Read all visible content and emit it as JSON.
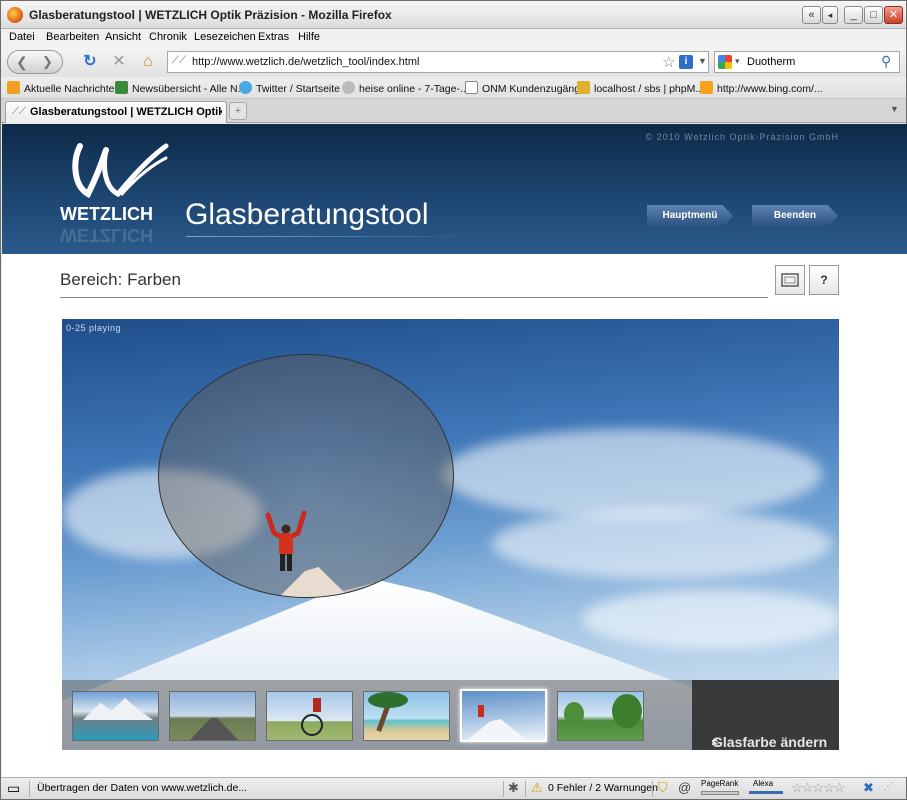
{
  "window": {
    "title": "Glasberatungstool | WETZLICH Optik Präzision - Mozilla Firefox",
    "buttons": {
      "back_left": "«",
      "minimize": "_",
      "maximize": "□",
      "close": "✕"
    }
  },
  "menu": [
    "Datei",
    "Bearbeiten",
    "Ansicht",
    "Chronik",
    "Lesezeichen",
    "Extras",
    "Hilfe"
  ],
  "nav": {
    "url": "http://www.wetzlich.de/wetzlich_tool/index.html",
    "search_value": "Duotherm",
    "icons": [
      "back-icon",
      "forward-icon",
      "reload-icon",
      "stop-icon",
      "home-icon",
      "bookmark-star-icon",
      "search-icon"
    ]
  },
  "bookmarks": [
    {
      "label": "Aktuelle Nachrichten",
      "color": "#f0a020"
    },
    {
      "label": "Newsübersicht - Alle N...",
      "color": "#3a8a3a"
    },
    {
      "label": "Twitter / Startseite",
      "color": "#4aa8e0"
    },
    {
      "label": "heise online - 7-Tage-...",
      "color": "#bbbbbb"
    },
    {
      "label": "ONM Kundenzugänge",
      "color": "#ffffff"
    },
    {
      "label": "localhost / sbs | phpM...",
      "color": "#e0b030"
    },
    {
      "label": "http://www.bing.com/...",
      "color": "#f7a21b"
    }
  ],
  "tab": {
    "label": "Glasberatungstool | WETZLICH Optik..."
  },
  "page": {
    "copyright": "© 2010 Wetzlich Optik-Präzision GmbH",
    "logo_text": "WETZLICH",
    "app_title": "Glasberatungstool",
    "btn_main": "Hauptmenü",
    "btn_exit": "Beenden",
    "section": "Bereich: Farben",
    "btn_fullscreen_icon": "fullscreen-icon",
    "btn_help": "?",
    "playing": "0-25 playing",
    "change_color": "Glasfarbe ändern",
    "change_icon": "«"
  },
  "thumbs": [
    {
      "name": "mountain-lake",
      "c1": "#6fa3d8",
      "c2": "#2a9ab8"
    },
    {
      "name": "road",
      "c1": "#8fb3d9",
      "c2": "#6b7b55"
    },
    {
      "name": "cyclist",
      "c1": "#a8c8e8",
      "c2": "#8ba860"
    },
    {
      "name": "beach-palm",
      "c1": "#8cc0e8",
      "c2": "#d8c89a"
    },
    {
      "name": "snow-climber",
      "c1": "#5f8fc8",
      "c2": "#eef3f8"
    },
    {
      "name": "park-trees",
      "c1": "#9cc4e6",
      "c2": "#4a8a3a"
    }
  ],
  "status": {
    "text": "Übertragen der Daten von www.wetzlich.de...",
    "errors": "0 Fehler / 2 Warnungen",
    "pagerank": "PageRank",
    "alexa": "Alexa"
  }
}
